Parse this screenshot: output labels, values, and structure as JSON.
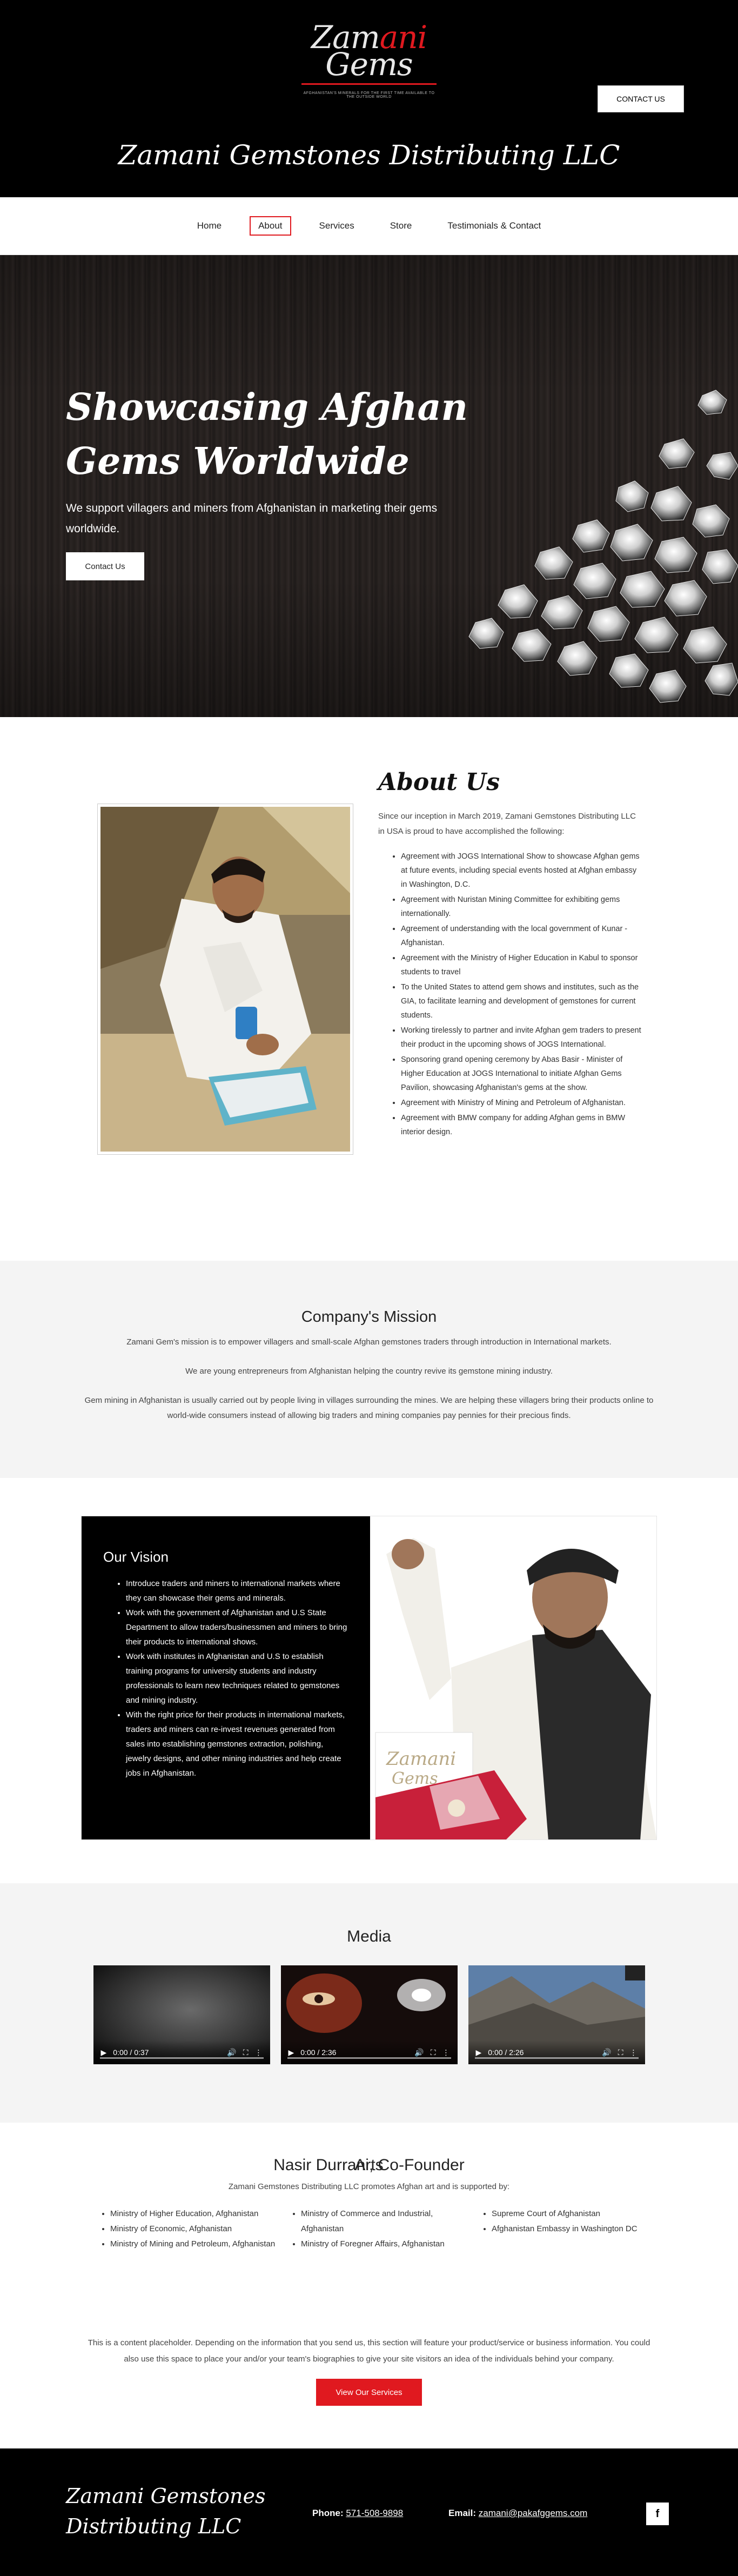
{
  "header": {
    "logo_part1": "Zam",
    "logo_part2": "ani",
    "logo_part3": "Gems",
    "logo_tagline": "Afghanistan's minerals for the first time available to the outside world",
    "contact_button": "CONTACT US",
    "site_title": "Zamani Gemstones Distributing LLC"
  },
  "nav": {
    "items": [
      {
        "label": "Home"
      },
      {
        "label": "About"
      },
      {
        "label": "Services"
      },
      {
        "label": "Store"
      },
      {
        "label": "Testimonials & Contact"
      }
    ],
    "active": "About"
  },
  "hero": {
    "title": "Showcasing Afghan Gems Worldwide",
    "subtitle": "We support villagers and miners from Afghanistan in marketing their gems worldwide.",
    "button": "Contact Us"
  },
  "about": {
    "title": "About Us",
    "intro": "Since our inception in March 2019, Zamani Gemstones Distributing LLC in USA is proud to have accomplished the following:",
    "items": [
      "Agreement with JOGS International Show to showcase Afghan gems at future events, including special events hosted at Afghan embassy in Washington, D.C.",
      "Agreement with Nuristan Mining Committee for exhibiting gems internationally.",
      "Agreement of understanding with the local government of Kunar - Afghanistan.",
      "Agreement with the Ministry of Higher Education in Kabul to sponsor students to travel",
      "To the United States to attend gem shows and institutes, such as the GIA, to facilitate learning and development of gemstones for current students.",
      "Working tirelessly to partner and invite Afghan gem traders to present their product in the upcoming shows of JOGS International.",
      "Sponsoring grand opening ceremony by Abas Basir - Minister of Higher Education at JOGS International to initiate Afghan Gems Pavilion, showcasing Afghanistan's gems at the show.",
      "Agreement with Ministry of Mining and Petroleum of Afghanistan.",
      "Agreement with BMW company for adding Afghan gems in BMW interior design."
    ]
  },
  "mission": {
    "title": "Company's Mission",
    "paragraphs": [
      "Zamani Gem's mission is to empower villagers and small-scale Afghan gemstones traders through introduction in International markets.",
      "We are young entrepreneurs from Afghanistan helping the country revive its gemstone mining industry.",
      "Gem mining in Afghanistan is usually carried out by people living in villages surrounding the mines. We are helping these villagers bring their products online to world-wide consumers instead of allowing big traders and mining companies pay pennies for their precious finds."
    ]
  },
  "vision": {
    "title": "Our Vision",
    "items": [
      "Introduce traders and miners to international markets where they can showcase their gems and minerals.",
      "Work with the government of Afghanistan and U.S State Department to allow traders/businessmen and miners to bring their products to international shows.",
      "Work with institutes in Afghanistan and U.S to establish training programs for university students and industry professionals to learn new techniques related to gemstones and mining industry.",
      "With the right price for their products in international markets, traders and miners can re-invest revenues generated from sales into establishing gemstones extraction, polishing, jewelry designs, and other mining industries and help create jobs in Afghanistan."
    ]
  },
  "media": {
    "title": "Media",
    "videos": [
      {
        "time": "0:00 / 0:37"
      },
      {
        "time": "0:00 / 2:36"
      },
      {
        "time": "0:00 / 2:26"
      }
    ]
  },
  "arts": {
    "title": "Arts",
    "intro": "Zamani Gemstones Distributing LLC promotes Afghan art and is supported by:",
    "col1": [
      "Ministry of Higher Education, Afghanistan",
      "Ministry of Economic, Afghanistan",
      "Ministry of Mining and Petroleum, Afghanistan"
    ],
    "col2": [
      "Ministry of Commerce and Industrial, Afghanistan",
      "Ministry of Foregner Affairs, Afghanistan"
    ],
    "col3": [
      "Supreme Court of Afghanistan",
      "Afghanistan Embassy in Washington DC"
    ]
  },
  "founder": {
    "title": "Nasir Durrani, Co-Founder",
    "text": "This is a content placeholder. Depending on the information that you send us, this section will feature your product/service or business information. You could also use this space to place your and/or your team's biographies to give your site visitors an idea of the individuals behind your company.",
    "button": "View Our Services"
  },
  "footer": {
    "title": "Zamani Gemstones Distributing LLC",
    "phone_label": "Phone:",
    "phone": "571-508-9898",
    "email_label": "Email:",
    "email": "zamani@pakafggems.com",
    "social_icon": "facebook-icon",
    "social_glyph": "f"
  },
  "colors": {
    "accent": "#e0191f",
    "dark": "#000000",
    "light_section": "#f4f4f4"
  }
}
